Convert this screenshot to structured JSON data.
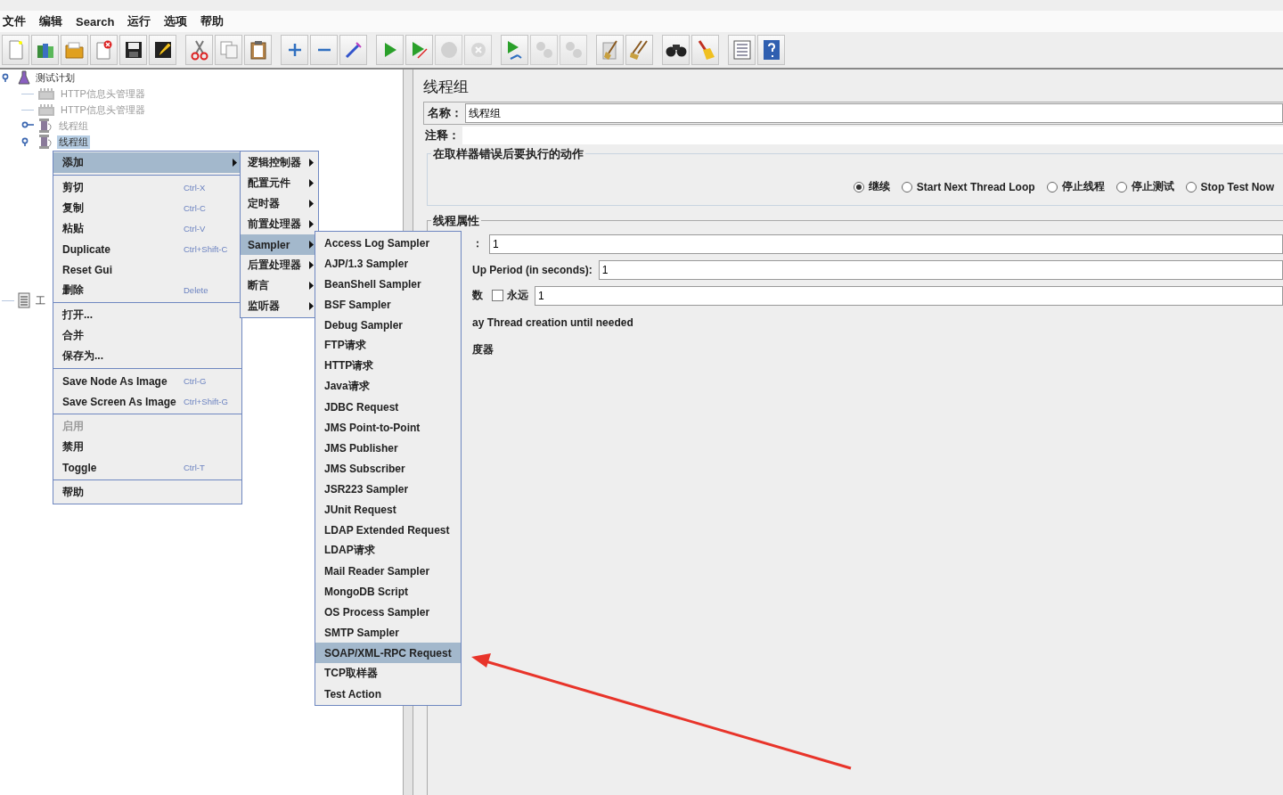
{
  "menu_bar": [
    {
      "label": "文件"
    },
    {
      "label": "编辑"
    },
    {
      "label": "Search"
    },
    {
      "label": "运行"
    },
    {
      "label": "选项"
    },
    {
      "label": "帮助"
    }
  ],
  "toolbar": [
    {
      "kind": "new",
      "disabled": false
    },
    {
      "kind": "templates",
      "disabled": false
    },
    {
      "kind": "open",
      "disabled": false
    },
    {
      "kind": "close",
      "disabled": false
    },
    {
      "kind": "save",
      "disabled": false
    },
    {
      "kind": "save-image",
      "disabled": false
    },
    {
      "kind": "gap"
    },
    {
      "kind": "cut",
      "disabled": false
    },
    {
      "kind": "copy",
      "disabled": false
    },
    {
      "kind": "paste",
      "disabled": false
    },
    {
      "kind": "gap"
    },
    {
      "kind": "expand",
      "disabled": false
    },
    {
      "kind": "collapse",
      "disabled": false
    },
    {
      "kind": "toggle",
      "disabled": false
    },
    {
      "kind": "gap"
    },
    {
      "kind": "start",
      "disabled": false
    },
    {
      "kind": "start-no-timers",
      "disabled": false
    },
    {
      "kind": "stop",
      "disabled": true
    },
    {
      "kind": "shutdown",
      "disabled": true
    },
    {
      "kind": "gap"
    },
    {
      "kind": "remote-start",
      "disabled": false
    },
    {
      "kind": "remote-stop",
      "disabled": true
    },
    {
      "kind": "remote-shutdown",
      "disabled": true
    },
    {
      "kind": "gap"
    },
    {
      "kind": "clear",
      "disabled": false
    },
    {
      "kind": "clear-all",
      "disabled": false
    },
    {
      "kind": "gap"
    },
    {
      "kind": "search",
      "disabled": false
    },
    {
      "kind": "reset-search",
      "disabled": false
    },
    {
      "kind": "gap"
    },
    {
      "kind": "function-helper",
      "disabled": false
    },
    {
      "kind": "help",
      "disabled": false
    }
  ],
  "tree": [
    {
      "label": "测试计划",
      "kind": "plan",
      "disabled": false,
      "selected": false,
      "expanded": true,
      "children": [
        {
          "label": "HTTP信息头管理器",
          "kind": "config",
          "disabled": true,
          "selected": false
        },
        {
          "label": "HTTP信息头管理器",
          "kind": "config",
          "disabled": true,
          "selected": false
        },
        {
          "label": "线程组",
          "kind": "thread-group",
          "disabled": true,
          "selected": false,
          "expanded": false
        },
        {
          "label": "线程组",
          "kind": "thread-group",
          "disabled": false,
          "selected": true,
          "expanded": true
        }
      ]
    },
    {
      "label": "工",
      "kind": "workbench",
      "disabled": false,
      "selected": false
    }
  ],
  "context_menu": [
    {
      "kind": "item",
      "label": "添加",
      "submenu": true,
      "selected": true,
      "disabled": false
    },
    {
      "kind": "separator"
    },
    {
      "kind": "item",
      "label": "剪切",
      "shortcut": "Ctrl-X",
      "selected": false,
      "disabled": false
    },
    {
      "kind": "item",
      "label": "复制",
      "shortcut": "Ctrl-C",
      "selected": false,
      "disabled": false
    },
    {
      "kind": "item",
      "label": "粘贴",
      "shortcut": "Ctrl-V",
      "selected": false,
      "disabled": false
    },
    {
      "kind": "item",
      "label": "Duplicate",
      "shortcut": "Ctrl+Shift-C",
      "selected": false,
      "disabled": false
    },
    {
      "kind": "item",
      "label": "Reset Gui",
      "selected": false,
      "disabled": false
    },
    {
      "kind": "item",
      "label": "删除",
      "shortcut": "Delete",
      "selected": false,
      "disabled": false
    },
    {
      "kind": "separator"
    },
    {
      "kind": "item",
      "label": "打开...",
      "selected": false,
      "disabled": false
    },
    {
      "kind": "item",
      "label": "合并",
      "selected": false,
      "disabled": false
    },
    {
      "kind": "item",
      "label": "保存为...",
      "selected": false,
      "disabled": false
    },
    {
      "kind": "separator"
    },
    {
      "kind": "item",
      "label": "Save Node As Image",
      "shortcut": "Ctrl-G",
      "selected": false,
      "disabled": false
    },
    {
      "kind": "item",
      "label": "Save Screen As Image",
      "shortcut": "Ctrl+Shift-G",
      "selected": false,
      "disabled": false
    },
    {
      "kind": "separator"
    },
    {
      "kind": "item",
      "label": "启用",
      "selected": false,
      "disabled": true
    },
    {
      "kind": "item",
      "label": "禁用",
      "selected": false,
      "disabled": false
    },
    {
      "kind": "item",
      "label": "Toggle",
      "shortcut": "Ctrl-T",
      "selected": false,
      "disabled": false
    },
    {
      "kind": "separator"
    },
    {
      "kind": "item",
      "label": "帮助",
      "selected": false,
      "disabled": false
    }
  ],
  "add_submenu": [
    {
      "label": "逻辑控制器",
      "selected": false
    },
    {
      "label": "配置元件",
      "selected": false
    },
    {
      "label": "定时器",
      "selected": false
    },
    {
      "label": "前置处理器",
      "selected": false
    },
    {
      "label": "Sampler",
      "selected": true
    },
    {
      "label": "后置处理器",
      "selected": false
    },
    {
      "label": "断言",
      "selected": false
    },
    {
      "label": "监听器",
      "selected": false
    }
  ],
  "sampler_submenu": [
    {
      "label": "Access Log Sampler",
      "selected": false
    },
    {
      "label": "AJP/1.3 Sampler",
      "selected": false
    },
    {
      "label": "BeanShell Sampler",
      "selected": false
    },
    {
      "label": "BSF Sampler",
      "selected": false
    },
    {
      "label": "Debug Sampler",
      "selected": false
    },
    {
      "label": "FTP请求",
      "selected": false
    },
    {
      "label": "HTTP请求",
      "selected": false
    },
    {
      "label": "Java请求",
      "selected": false
    },
    {
      "label": "JDBC Request",
      "selected": false
    },
    {
      "label": "JMS Point-to-Point",
      "selected": false
    },
    {
      "label": "JMS Publisher",
      "selected": false
    },
    {
      "label": "JMS Subscriber",
      "selected": false
    },
    {
      "label": "JSR223 Sampler",
      "selected": false
    },
    {
      "label": "JUnit Request",
      "selected": false
    },
    {
      "label": "LDAP Extended Request",
      "selected": false
    },
    {
      "label": "LDAP请求",
      "selected": false
    },
    {
      "label": "Mail Reader Sampler",
      "selected": false
    },
    {
      "label": "MongoDB Script",
      "selected": false
    },
    {
      "label": "OS Process Sampler",
      "selected": false
    },
    {
      "label": "SMTP Sampler",
      "selected": false
    },
    {
      "label": "SOAP/XML-RPC Request",
      "selected": true
    },
    {
      "label": "TCP取样器",
      "selected": false
    },
    {
      "label": "Test Action",
      "selected": false
    }
  ],
  "panel": {
    "title": "线程组",
    "name": {
      "label": "名称：",
      "value": "线程组"
    },
    "comment": {
      "label": "注释："
    },
    "error_action": {
      "legend": "在取样器错误后要执行的动作",
      "options": [
        {
          "label": "继续",
          "selected": true
        },
        {
          "label": "Start Next Thread Loop",
          "selected": false
        },
        {
          "label": "停止线程",
          "selected": false
        },
        {
          "label": "停止测试",
          "selected": false
        },
        {
          "label": "Stop Test Now",
          "selected": false
        }
      ]
    },
    "thread_properties": {
      "legend": "线程属性",
      "threads": {
        "label": "：",
        "value": "1"
      },
      "ramp_up": {
        "label": "Up Period (in seconds):",
        "value": "1"
      },
      "loops": {
        "label": "数",
        "forever": {
          "label": "永远",
          "checked": false
        },
        "value": "1"
      },
      "delay": {
        "label": "ay Thread creation until needed"
      },
      "scheduler": {
        "label": "度器"
      }
    }
  }
}
